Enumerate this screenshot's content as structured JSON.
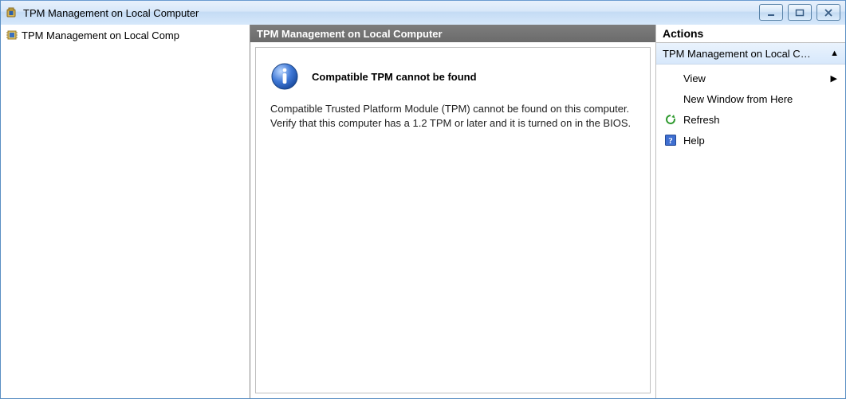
{
  "window": {
    "title": "TPM Management on Local Computer"
  },
  "tree": {
    "root_label": "TPM Management on Local Comp"
  },
  "center": {
    "header": "TPM Management on Local Computer",
    "info_title": "Compatible TPM cannot be found",
    "info_body": "Compatible Trusted Platform Module (TPM) cannot be found on this computer. Verify that this computer has a 1.2 TPM or later and it is turned on in the BIOS."
  },
  "actions": {
    "header": "Actions",
    "scope": "TPM Management on Local Co...",
    "items": {
      "view": "View",
      "new_window": "New Window from Here",
      "refresh": "Refresh",
      "help": "Help"
    }
  }
}
